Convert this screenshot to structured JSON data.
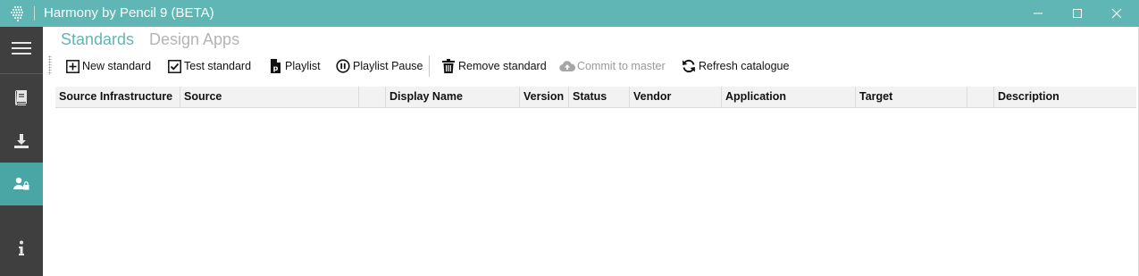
{
  "window": {
    "title": "Harmony by Pencil 9 (BETA)",
    "controls": {
      "minimize_icon": "minimize-icon",
      "maximize_icon": "maximize-icon",
      "close_icon": "close-icon"
    }
  },
  "theme": {
    "accent": "#5fb6b4",
    "sidebar_bg": "#3f3f3f",
    "sidebar_active": "#4aa6a4",
    "inactive_tab": "#b4b4b4"
  },
  "sidebar": {
    "items": [
      {
        "name": "menu",
        "icon": "hamburger-menu-icon"
      },
      {
        "name": "book",
        "icon": "book-icon"
      },
      {
        "name": "download",
        "icon": "download-icon"
      },
      {
        "name": "user-lock",
        "icon": "user-lock-icon",
        "active": true
      },
      {
        "name": "info",
        "icon": "info-icon"
      }
    ]
  },
  "tabs": [
    {
      "label": "Standards",
      "active": true
    },
    {
      "label": "Design Apps",
      "active": false
    }
  ],
  "toolbar": {
    "new_standard": "New standard",
    "test_standard": "Test standard",
    "playlist": "Playlist",
    "playlist_pause": "Playlist Pause",
    "remove_standard": "Remove standard",
    "commit_to_master": "Commit to master",
    "refresh_catalogue": "Refresh catalogue"
  },
  "grid": {
    "columns": [
      "Source Infrastructure",
      "Source",
      "",
      "Display Name",
      "Version",
      "Status",
      "Vendor",
      "Application",
      "Target",
      "",
      "Description"
    ],
    "rows": []
  }
}
